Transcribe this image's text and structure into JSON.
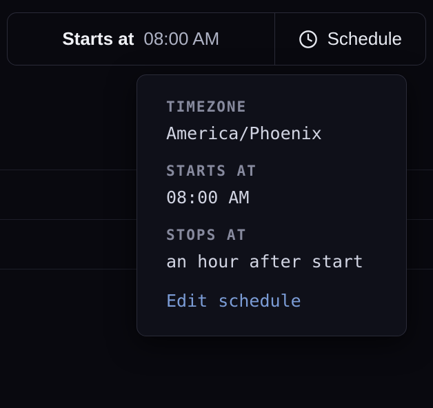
{
  "toolbar": {
    "starts_label": "Starts at",
    "starts_time": "08:00 AM",
    "schedule_label": "Schedule"
  },
  "popover": {
    "timezone_label": "TIMEZONE",
    "timezone_value": "America/Phoenix",
    "starts_label": "STARTS AT",
    "starts_value": "08:00 AM",
    "stops_label": "STOPS AT",
    "stops_value": "an hour after start",
    "edit_link": "Edit schedule"
  }
}
